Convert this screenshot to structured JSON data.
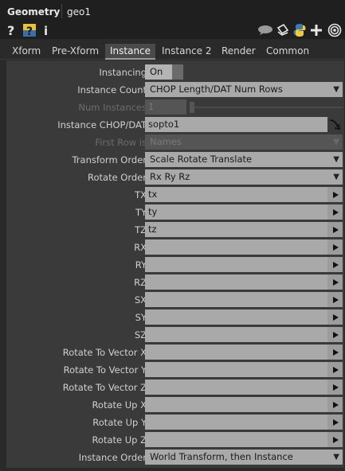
{
  "header": {
    "op_type": "Geometry",
    "op_name": "geo1"
  },
  "toolbar": {
    "left_icons": [
      "help-icon",
      "python-help-icon",
      "info-icon"
    ],
    "right_icons": [
      "comment-icon",
      "clone-icon",
      "python-icon",
      "add-icon",
      "target-icon"
    ]
  },
  "tabs": [
    {
      "label": "Xform"
    },
    {
      "label": "Pre-Xform"
    },
    {
      "label": "Instance"
    },
    {
      "label": "Instance 2"
    },
    {
      "label": "Render"
    },
    {
      "label": "Common"
    }
  ],
  "active_tab": "Instance",
  "params": {
    "instancing": {
      "label": "Instancing",
      "value": "On"
    },
    "instance_count": {
      "label": "Instance Count",
      "value": "CHOP Length/DAT Num Rows"
    },
    "num_instances": {
      "label": "Num Instances",
      "value": "1"
    },
    "instance_chop": {
      "label": "Instance CHOP/DAT",
      "value": "sopto1"
    },
    "first_row_is": {
      "label": "First Row is",
      "value": "Names"
    },
    "transform_order": {
      "label": "Transform Order",
      "value": "Scale Rotate Translate"
    },
    "rotate_order": {
      "label": "Rotate Order",
      "value": "Rx Ry Rz"
    },
    "tx": {
      "label": "TX",
      "value": "tx"
    },
    "ty": {
      "label": "TY",
      "value": "ty"
    },
    "tz": {
      "label": "TZ",
      "value": "tz"
    },
    "rx": {
      "label": "RX",
      "value": ""
    },
    "ry": {
      "label": "RY",
      "value": ""
    },
    "rz": {
      "label": "RZ",
      "value": ""
    },
    "sx": {
      "label": "SX",
      "value": ""
    },
    "sy": {
      "label": "SY",
      "value": ""
    },
    "sz": {
      "label": "SZ",
      "value": ""
    },
    "rtvx": {
      "label": "Rotate To Vector X",
      "value": ""
    },
    "rtvy": {
      "label": "Rotate To Vector Y",
      "value": ""
    },
    "rtvz": {
      "label": "Rotate To Vector Z",
      "value": ""
    },
    "rux": {
      "label": "Rotate Up X",
      "value": ""
    },
    "ruy": {
      "label": "Rotate Up Y",
      "value": ""
    },
    "ruz": {
      "label": "Rotate Up Z",
      "value": ""
    },
    "instance_order": {
      "label": "Instance Order",
      "value": "World Transform, then Instance"
    }
  }
}
